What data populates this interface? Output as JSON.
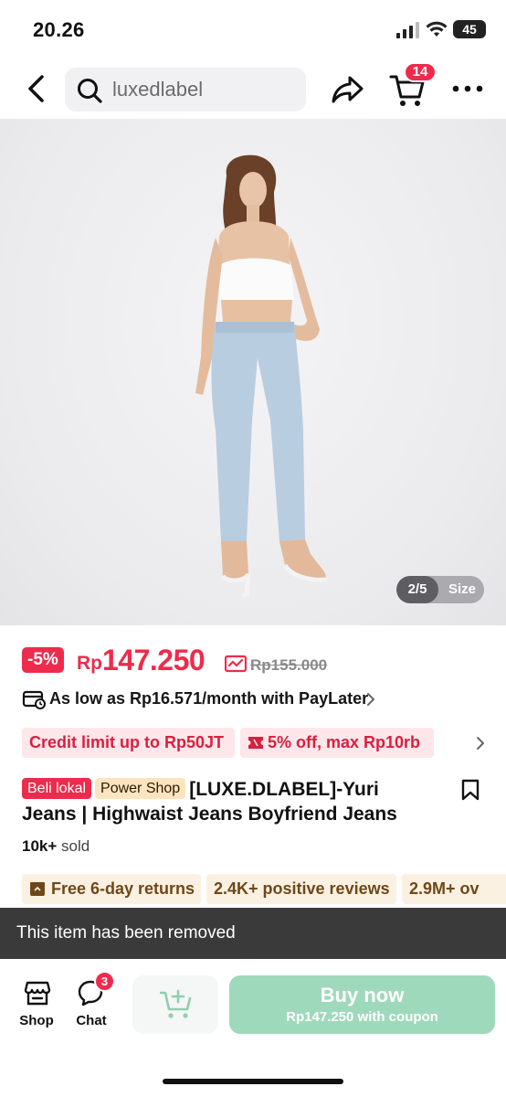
{
  "status_bar": {
    "time": "20.26",
    "battery": "45"
  },
  "nav": {
    "search_text": "luxedlabel",
    "cart_count": "14"
  },
  "gallery": {
    "index": "2/5",
    "size_label": "Size"
  },
  "price": {
    "discount": "-5%",
    "currency": "Rp",
    "value": "147.250",
    "original": "Rp155.000"
  },
  "paylater": {
    "text": "As low as Rp16.571/month with PayLater"
  },
  "promos": [
    {
      "label": "Credit limit up to Rp50JT"
    },
    {
      "label": "5% off, max Rp10rb"
    }
  ],
  "product": {
    "tags": [
      "Beli lokal",
      "Power Shop"
    ],
    "title_line1": "[LUXE.DLABEL]-Yuri",
    "title_line2": "Jeans | Highwaist Jeans Boyfriend Jeans",
    "sold_count": "10k+",
    "sold_label": "sold"
  },
  "features": [
    {
      "label": "Free 6-day returns"
    },
    {
      "label": "2.4K+ positive reviews"
    },
    {
      "label": "2.9M+ ov"
    }
  ],
  "toast": {
    "text": "This item has been removed"
  },
  "bottom_bar": {
    "shop_label": "Shop",
    "chat_label": "Chat",
    "chat_badge": "3",
    "buy_now": "Buy now",
    "buy_now_sub": "Rp147.250 with coupon"
  },
  "colors": {
    "accent_red": "#ee2b4c",
    "buy_green": "#9fd9bb",
    "feature_brown": "#6e4818"
  }
}
